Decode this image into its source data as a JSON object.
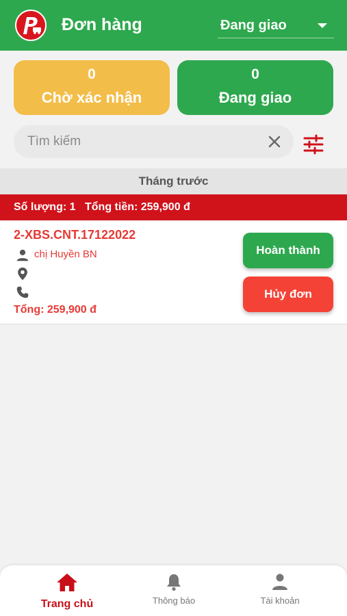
{
  "header": {
    "title": "Đơn hàng",
    "status_value": "Đang giao",
    "logo_icon": "app-logo-icon"
  },
  "summary": {
    "pending": {
      "count": "0",
      "label": "Chờ xác nhận",
      "color": "#f3bd49"
    },
    "shipping": {
      "count": "0",
      "label": "Đang giao",
      "color": "#2ea84e"
    }
  },
  "search": {
    "placeholder": "Tìm kiếm"
  },
  "section": {
    "month_label": "Tháng trước",
    "quantity": "Số lượng: 1",
    "total": "Tổng tiền: 259,900 đ"
  },
  "orders": [
    {
      "code": "2-XBS.CNT.17122022",
      "customer": "chị Huyền BN",
      "address": "",
      "phone": "",
      "total": "Tổng: 259,900 đ",
      "complete_label": "Hoàn thành",
      "cancel_label": "Hủy đơn"
    }
  ],
  "tabs": [
    {
      "label": "Trang chủ",
      "icon": "home-icon",
      "active": true
    },
    {
      "label": "Thông báo",
      "icon": "bell-icon",
      "active": false
    },
    {
      "label": "Tài khoản",
      "icon": "person-icon",
      "active": false
    }
  ],
  "colors": {
    "brand_green": "#2ea84e",
    "brand_red": "#d0121b",
    "accent_yellow": "#f3bd49"
  }
}
